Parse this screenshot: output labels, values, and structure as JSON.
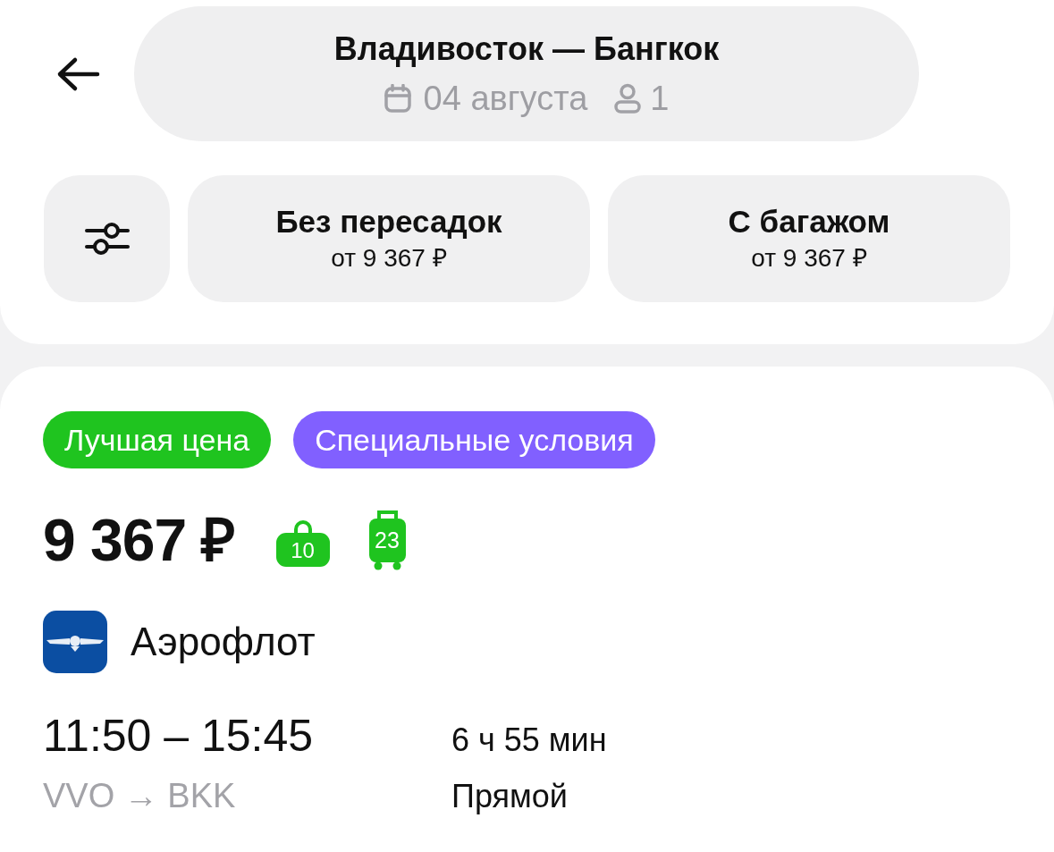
{
  "header": {
    "route": "Владивосток — Бангкок",
    "date": "04 августа",
    "passengers": "1"
  },
  "filters": [
    {
      "title": "Без пересадок",
      "price": "от 9 367 ₽",
      "selected": false
    },
    {
      "title": "С багажом",
      "price": "от 9 367 ₽",
      "selected": false
    }
  ],
  "offer": {
    "badges": [
      {
        "label": "Лучшая цена",
        "color": "#1fc41f"
      },
      {
        "label": "Специальные условия",
        "color": "#8160ff"
      }
    ],
    "price": "9 367 ₽",
    "baggage": [
      {
        "kind": "hand",
        "weight": "10"
      },
      {
        "kind": "checked",
        "weight": "23"
      }
    ],
    "airline": "Аэрофлот",
    "times": "11:50 – 15:45",
    "airports": "VVO → BKK",
    "duration": "6 ч 55 мин",
    "stops": "Прямой"
  }
}
